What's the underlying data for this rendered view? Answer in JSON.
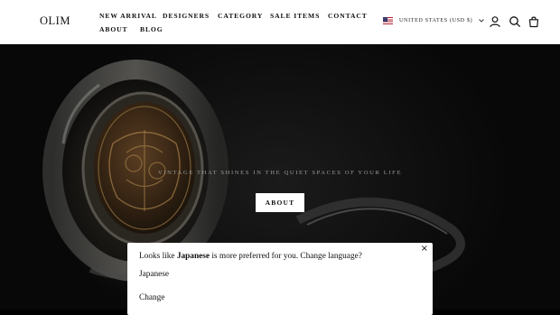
{
  "header": {
    "logo": "OLIM",
    "nav": [
      "NEW ARRIVAL",
      "DESIGNERS",
      "CATEGORY",
      "SALE ITEMS",
      "CONTACT",
      "ABOUT",
      "BLOG"
    ],
    "locale": "UNITED STATES (USD $)",
    "icons": [
      "us-flag-icon",
      "chevron-down-icon",
      "account-icon",
      "search-icon",
      "cart-icon"
    ]
  },
  "hero": {
    "tagline": "VINTAGE THAT SHINES IN THE QUIET SPACES OF YOUR LIFE",
    "button": "ABOUT"
  },
  "popup": {
    "close": "×",
    "message_prefix": "Looks like ",
    "message_language": "Japanese",
    "message_suffix": " is more preferred for you. Change language?",
    "option_language": "Japanese",
    "option_change": "Change"
  },
  "colors": {
    "header_bg": "#ffffff",
    "hero_bg": "#0d0d0d",
    "text": "#111111"
  }
}
